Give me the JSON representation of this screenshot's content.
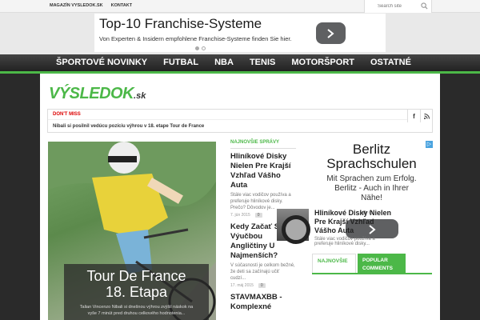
{
  "topbar": {
    "links": [
      "MAGAZÍN VYSLEDOK.SK",
      "KONTAKT"
    ],
    "search_placeholder": "Search site"
  },
  "ad_top": {
    "headline": "Top-10 Franchise-Systeme",
    "subline": "Von Experten & Insidern empfohlene Franchise-Systeme finden Sie hier."
  },
  "nav": {
    "items": [
      "ŠPORTOVÉ NOVINKY",
      "FUTBAL",
      "NBA",
      "TENIS",
      "MOTORŠPORT",
      "OSTATNÉ"
    ]
  },
  "logo": {
    "main": "VÝSLEDOK",
    "suffix": ".sk"
  },
  "dont_miss": {
    "label": "DON'T MISS",
    "text": "Nibali si posilnil vedúcu pozíciu výhrou v 18. etape Tour de France",
    "social": [
      "f",
      "rss"
    ]
  },
  "hero": {
    "title_line1": "Tour De France",
    "title_line2": "18. Etapa",
    "desc_line1": "Talian Vincenzo Nibali si dnešnou výhrou zvýšil náskok na",
    "desc_line2": "vyše 7 minút pred druhou celkového hodnotenia..."
  },
  "news": {
    "header": "NAJNOVŠIE SPRÁVY",
    "items": [
      {
        "title": "Hliníkové Disky Nielen Pre Krajší Vzhľad Vášho Auta",
        "desc": "Stále viac vodičov používa a preferuje hliníkové disky. Prečo? Dôvodov je...",
        "date": "7. jún 2015",
        "count": "0"
      },
      {
        "title": "Kedy Začať S Výučbou Angličtiny U Najmenších?",
        "desc": "V súčasnosti je celkom bežné, že deti sa začínajú učiť cudzí...",
        "date": "17. máj 2015",
        "count": "0"
      },
      {
        "title": "STAVMAXBB - Komplexné",
        "desc": "",
        "date": "",
        "count": ""
      }
    ]
  },
  "ad_right": {
    "headline_line1": "Berlitz",
    "headline_line2": "Sprachschulen",
    "sub_line1": "Mit Sprachen zum Erfolg.",
    "sub_line2": "Berlitz - Auch in Ihrer",
    "sub_line3": "Nähe!"
  },
  "tabs": {
    "tab1": "NAJNOVŠIE",
    "tab2_line1": "POPULAR",
    "tab2_line2": "COMMENTS"
  },
  "popular": {
    "title": "Hliníkové Disky Nielen Pre Krajší Vzhľad Vášho Auta",
    "desc": "Stále viac vodičov používa a preferuje hliníkové disky..."
  }
}
